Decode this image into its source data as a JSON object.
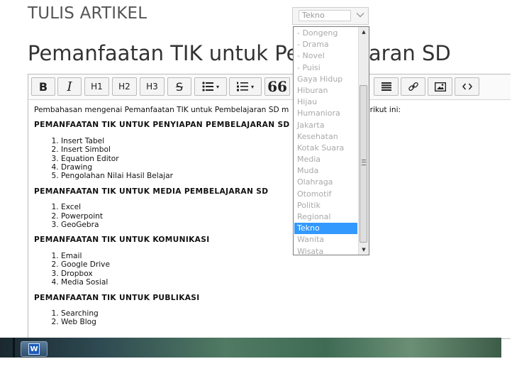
{
  "page": {
    "heading": "TULIS ARTIKEL",
    "article_title": "Pemanfaatan TIK untuk Pembelajaran SD"
  },
  "toolbar": {
    "bold": "B",
    "italic": "I",
    "h1": "H1",
    "h2": "H2",
    "h3": "H3",
    "strike": "S",
    "quote": "66",
    "dropdown_caret": "▾",
    "icons": [
      "bold-icon",
      "italic-icon",
      "strikethrough-icon",
      "bullet-list-icon",
      "numbered-list-icon",
      "quote-icon",
      "justify-icon",
      "link-icon",
      "image-icon",
      "code-icon"
    ]
  },
  "category_select": {
    "value": "Tekno",
    "options": [
      "- Dongeng",
      "- Drama",
      "- Novel",
      "- Puisi",
      "Gaya Hidup",
      "Hiburan",
      "Hijau",
      "Humaniora",
      "Jakarta",
      "Kesehatan",
      "Kotak Suara",
      "Media",
      "Muda",
      "Olahraga",
      "Otomotif",
      "Politik",
      "Regional",
      "Tekno",
      "Wanita",
      "Wisata"
    ],
    "selected_index": 17
  },
  "content": {
    "intro": "Pembahasan mengenai Pemanfaatan TIK untuk Pembelajaran SD m",
    "intro_tail": "berikut ini:",
    "sections": [
      {
        "heading": "PEMANFAATAN TIK UNTUK PENYIAPAN PEMBELAJARAN SD",
        "items": [
          "Insert Tabel",
          "Insert Simbol",
          "Equation Editor",
          "Drawing",
          "Pengolahan Nilai Hasil Belajar"
        ]
      },
      {
        "heading": "PEMANFAATAN TIK UNTUK MEDIA PEMBELAJARAN SD",
        "items": [
          "Excel",
          "Powerpoint",
          "GeoGebra"
        ]
      },
      {
        "heading": "PEMANFAATAN TIK UNTUK KOMUNIKASI",
        "items": [
          "Email",
          "Google Drive",
          "Dropbox",
          "Media Sosial"
        ]
      },
      {
        "heading": "PEMANFAATAN TIK UNTUK PUBLIKASI",
        "items": [
          "Searching",
          "Web Blog"
        ]
      }
    ]
  },
  "taskbar": {
    "word_label": "W"
  },
  "colors": {
    "selected_option": "#3399ff",
    "option_text": "#a9a9a9"
  }
}
